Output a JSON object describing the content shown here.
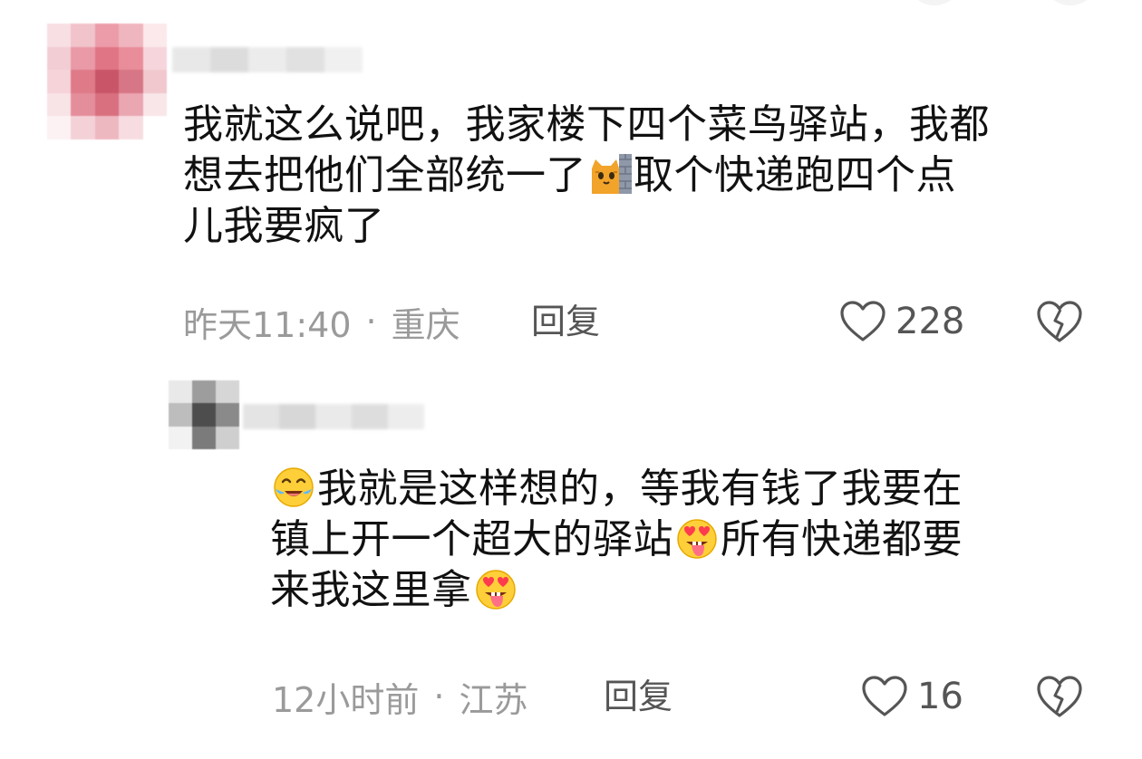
{
  "comments": [
    {
      "text_lines": [
        "我就这么说吧，我家楼下四个菜鸟驿站，我都",
        "想去把他们全部统一了",
        "取个快递跑四个点",
        "儿我要疯了"
      ],
      "time": "昨天11:40",
      "location": "重庆",
      "reply_label": "回复",
      "like_count": "228"
    },
    {
      "text_lines": [
        "我就是这样想的，等我有钱了我要在",
        "镇上开一个超大的驿站",
        "所有快递都要",
        "来我这里拿"
      ],
      "time": "12小时前",
      "location": "江苏",
      "reply_label": "回复",
      "like_count": "16"
    }
  ],
  "separator": "·",
  "icons": {
    "like": "heart-outline-icon",
    "dislike": "broken-heart-icon",
    "emoji_cat": "cat-peeking-emoji",
    "emoji_laugh": "laughing-tears-emoji",
    "emoji_heart_eyes": "heart-eyes-tongue-emoji"
  }
}
